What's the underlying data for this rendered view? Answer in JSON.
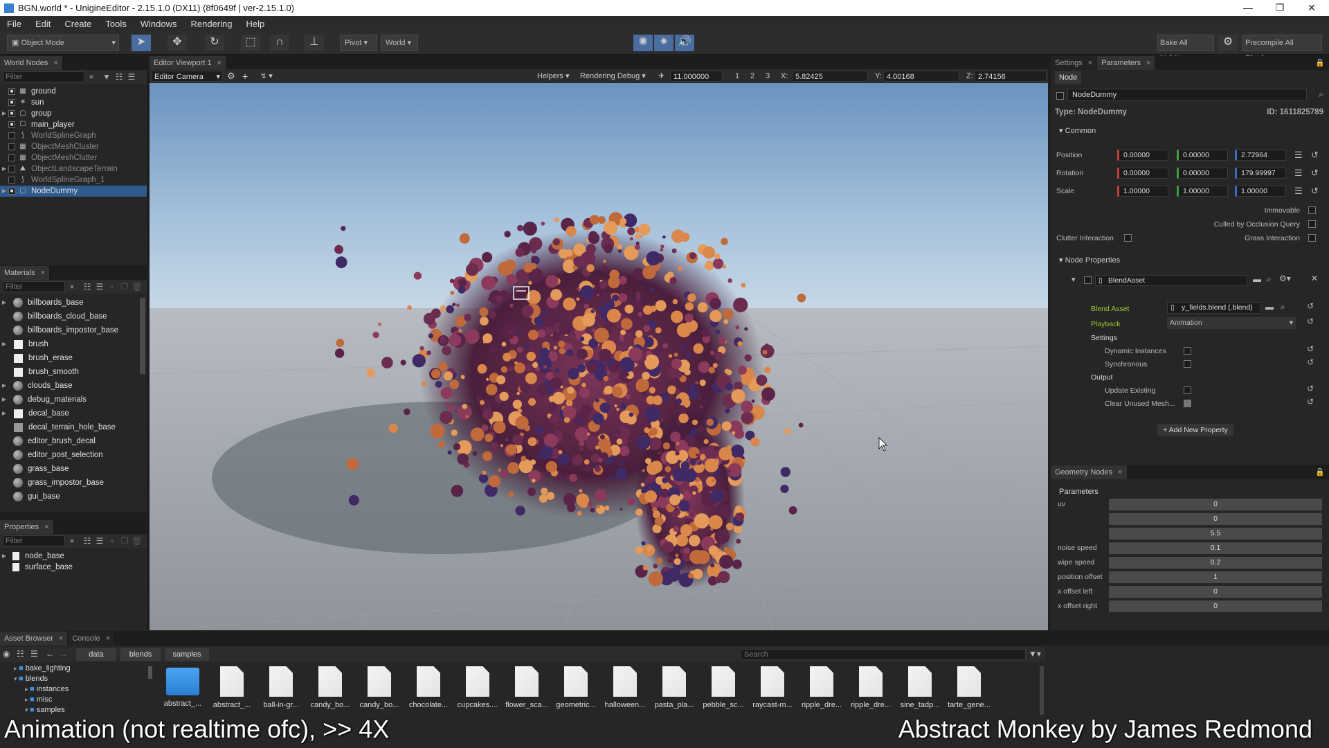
{
  "window": {
    "title": "BGN.world * - UnigineEditor - 2.15.1.0 (DX11) (8f0649f | ver-2.15.1.0)"
  },
  "menu": [
    "File",
    "Edit",
    "Create",
    "Tools",
    "Windows",
    "Rendering",
    "Help"
  ],
  "toolbar": {
    "mode": "Object Mode",
    "pivot": "Pivot",
    "world": "World",
    "bake": "Bake All Lighting",
    "precompile": "Precompile All Shaders"
  },
  "world_nodes": {
    "tab": "World Nodes",
    "filter_placeholder": "Filter",
    "items": [
      {
        "label": "ground",
        "dim": false,
        "selected": false
      },
      {
        "label": "sun",
        "dim": false,
        "selected": false
      },
      {
        "label": "group",
        "dim": false,
        "selected": false
      },
      {
        "label": "main_player",
        "dim": false,
        "selected": false
      },
      {
        "label": "WorldSplineGraph",
        "dim": true,
        "selected": false
      },
      {
        "label": "ObjectMeshCluster",
        "dim": true,
        "selected": false
      },
      {
        "label": "ObjectMeshClutter",
        "dim": true,
        "selected": false
      },
      {
        "label": "ObjectLandscapeTerrain",
        "dim": true,
        "selected": false
      },
      {
        "label": "WorldSplineGraph_1",
        "dim": true,
        "selected": false
      },
      {
        "label": "NodeDummy",
        "dim": false,
        "selected": true
      }
    ]
  },
  "materials": {
    "tab": "Materials",
    "filter_placeholder": "Filter",
    "items": [
      "billboards_base",
      "billboards_cloud_base",
      "billboards_impostor_base",
      "brush",
      "brush_erase",
      "brush_smooth",
      "clouds_base",
      "debug_materials",
      "decal_base",
      "decal_terrain_hole_base",
      "editor_brush_decal",
      "editor_post_selection",
      "grass_base",
      "grass_impostor_base",
      "gui_base"
    ]
  },
  "properties": {
    "tab": "Properties",
    "filter_placeholder": "Filter",
    "items": [
      "node_base",
      "surface_base"
    ]
  },
  "viewport": {
    "tab": "Editor Viewport 1",
    "camera": "Editor Camera",
    "helpers": "Helpers",
    "rendering_debug": "Rendering Debug",
    "speed": "11.000000",
    "btn1": "1",
    "btn2": "2",
    "btn3": "3",
    "x_label": "X:",
    "x": "5.82425",
    "y_label": "Y:",
    "y": "4.00168",
    "z_label": "Z:",
    "z": "2.74156"
  },
  "params": {
    "tab_settings": "Settings",
    "tab_parameters": "Parameters",
    "subtab": "Node",
    "node_name": "NodeDummy",
    "type": "Type: NodeDummy",
    "id": "ID: 1611825789",
    "common": "Common",
    "position_label": "Position",
    "position": [
      "0.00000",
      "0.00000",
      "2.72964"
    ],
    "rotation_label": "Rotation",
    "rotation": [
      "0.00000",
      "0.00000",
      "179.99997"
    ],
    "scale_label": "Scale",
    "scale": [
      "1.00000",
      "1.00000",
      "1.00000"
    ],
    "immovable": "Immovable",
    "culled": "Culled by Occlusion Query",
    "clutter": "Clutter Interaction",
    "grass": "Grass Interaction",
    "node_properties": "Node Properties",
    "blend_asset_prop": "BlendAsset",
    "blend_asset_label": "Blend Asset",
    "blend_asset_value": "y_fields.blend (.blend)",
    "playback_label": "Playback",
    "playback_value": "Animation",
    "settings_label": "Settings",
    "dynamic_instances": "Dynamic Instances",
    "synchronous": "Synchronous",
    "output_label": "Output",
    "update_existing": "Update Existing",
    "clear_unused": "Clear Unused Mesh...",
    "add_property": "Add New Property"
  },
  "geometry_nodes": {
    "tab": "Geometry Nodes",
    "header": "Parameters",
    "rows": [
      {
        "label": "uv",
        "value": "0"
      },
      {
        "label": "",
        "value": "0"
      },
      {
        "label": "",
        "value": "5.5"
      },
      {
        "label": "noise speed",
        "value": "0.1"
      },
      {
        "label": "wipe speed",
        "value": "0.2"
      },
      {
        "label": "position offset",
        "value": "1"
      },
      {
        "label": "x offset left",
        "value": "0"
      },
      {
        "label": "x offset right",
        "value": "0"
      }
    ]
  },
  "asset_browser": {
    "tab": "Asset Browser",
    "console_tab": "Console",
    "crumbs": [
      "data",
      "blends",
      "samples"
    ],
    "search_placeholder": "Search",
    "tree": [
      {
        "label": "bake_lighting",
        "indent": 1
      },
      {
        "label": "blends",
        "indent": 1
      },
      {
        "label": "instances",
        "indent": 2
      },
      {
        "label": "misc",
        "indent": 2
      },
      {
        "label": "samples",
        "indent": 2
      }
    ],
    "files": [
      "abstract_...",
      "abstract_...",
      "ball-in-gr...",
      "candy_bo...",
      "candy_bo...",
      "chocolate...",
      "cupcakes....",
      "flower_sca...",
      "geometric...",
      "halloween...",
      "pasta_pla...",
      "pebble_sc...",
      "raycast-m...",
      "ripple_dre...",
      "ripple_dre...",
      "sine_tadp...",
      "tarte_gene..."
    ]
  },
  "captions": {
    "left": "Animation (not realtime ofc), >> 4X",
    "right": "Abstract Monkey by James Redmond"
  }
}
